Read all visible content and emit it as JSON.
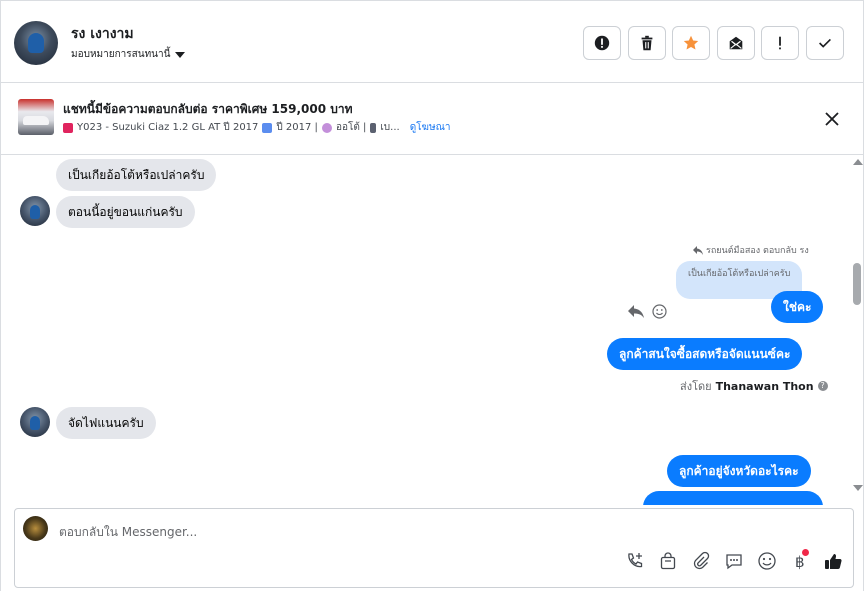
{
  "header": {
    "user_name": "รง เงางาม",
    "assign_label": "มอบหมายการสนทนานี้",
    "actions": [
      {
        "name": "mark-spam",
        "icon": "exclamation-circle-icon"
      },
      {
        "name": "delete",
        "icon": "trash-icon"
      },
      {
        "name": "star",
        "icon": "star-icon",
        "color": "#f7923b"
      },
      {
        "name": "mark-unread",
        "icon": "envelope-icon"
      },
      {
        "name": "follow-up",
        "icon": "exclamation-icon"
      },
      {
        "name": "mark-done",
        "icon": "checkmark-icon"
      }
    ]
  },
  "listing": {
    "title": "แชทนี้มีข้อความตอบกลับต่อ ราคาพิเศษ 159,000 บาท",
    "car": "Y023 - Suzuki Ciaz 1.2 GL AT ปี 2017",
    "year": "ปี 2017 |",
    "transmission": "ออโต้ |",
    "fuel": "เบ...",
    "link": "ดูโฆษณา"
  },
  "thread": {
    "messages_in": [
      {
        "text": "เป็นเกียอ้อโต้หรือเปล่าครับ"
      },
      {
        "text": "ตอนนี้อยู่ขอนแก่นครับ"
      },
      {
        "text": "จัดไฟแนนครับ"
      }
    ],
    "reply_meta": "รถยนต์มือสอง ตอบกลับ รง",
    "quoted_text": "เป็นเกียอ้อโต้หรือเปล่าครับ",
    "messages_out": [
      {
        "text": "ใช่คะ"
      },
      {
        "text": "ลูกค้าสนใจซื้อสดหรือจัดแนนซ์คะ"
      },
      {
        "text": "ลูกค้าอยู่จังหวัดอะไรคะ"
      }
    ],
    "sent_by_prefix": "ส่งโดย",
    "sent_by_name": "Thanawan Thon"
  },
  "composer": {
    "placeholder": "ตอบกลับใน Messenger...",
    "tools": [
      "call-icon",
      "shopping-bag-icon",
      "paperclip-icon",
      "saved-reply-icon",
      "emoji-icon",
      "baht-icon",
      "like-icon"
    ],
    "accent": "#0a7cff"
  }
}
